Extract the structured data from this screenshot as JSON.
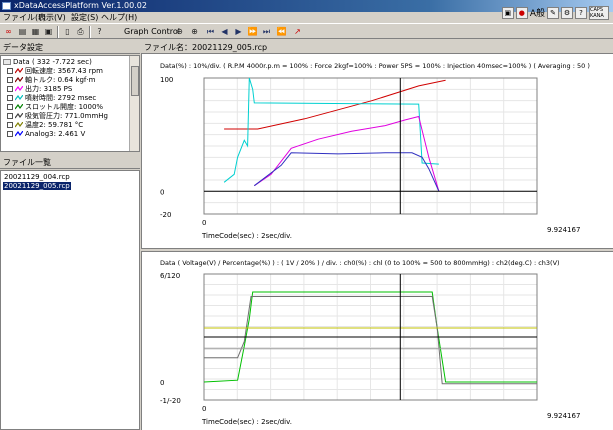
{
  "window": {
    "title": "xDataAccessPlatform  Ver.1.00.02"
  },
  "menu": [
    "ファイル(F)",
    "表示(V)",
    "設定(S)",
    "ヘルプ(H)"
  ],
  "toolbar": {
    "graph_control_label": "Graph Control"
  },
  "status": {
    "caps": "CAPS",
    "kana": "KANA",
    "ime_label": "A般"
  },
  "data_panel": {
    "header": "データ設定",
    "root": "Data ( 332 -7.722 sec)",
    "items": [
      {
        "label": "回転速度: 3567.43 rpm",
        "color": "#c00000"
      },
      {
        "label": "軸トルク: 0.64 kgf·m",
        "color": "#800000"
      },
      {
        "label": "出力: 3185 PS",
        "color": "#ff00ff"
      },
      {
        "label": "噴射時間: 2792 msec",
        "color": "#00c0c0"
      },
      {
        "label": "スロットル開度: 1000%",
        "color": "#008000"
      },
      {
        "label": "吸気管圧力: 771.0mmHg",
        "color": "#404040"
      },
      {
        "label": "温度2: 59.781 °C",
        "color": "#808000"
      },
      {
        "label": "Analog3: 2.461 V",
        "color": "#0000ff"
      }
    ]
  },
  "file_panel": {
    "header": "ファイル一覧",
    "files": [
      "20021129_004.rcp",
      "20021129_005.rcp"
    ],
    "selected_index": 1
  },
  "chart_header": "ファイル名：20021129_005.rcp",
  "chart_data": [
    {
      "type": "line",
      "title": "Data(%) : 10%/div. ( R.P.M 4000r.p.m = 100% : Force 2kgf=100% : Power 5PS = 100% : Injection 40msec=100% ) ( Averaging : 50 )",
      "ylim": [
        -20,
        100
      ],
      "y_ticks": [
        "100",
        "0",
        "-20"
      ],
      "xlim": [
        0,
        9.924167
      ],
      "x_ticks": [
        "0",
        "9.924167"
      ],
      "xlabel": "TimeCode(sec) :  2sec/div.",
      "cursor_x": 5.85,
      "series": [
        {
          "name": "red",
          "color": "#d00000",
          "x": [
            0.6,
            1.6,
            3,
            5,
            6.4,
            7.2
          ],
          "y": [
            55,
            55,
            64,
            80,
            93,
            98
          ]
        },
        {
          "name": "cyan",
          "color": "#00d0d0",
          "x": [
            0.6,
            0.9,
            1.0,
            1.2,
            1.3,
            1.35,
            1.45,
            1.5,
            6.4,
            6.5,
            7.0
          ],
          "y": [
            8,
            15,
            30,
            45,
            40,
            100,
            90,
            78,
            77,
            25,
            24
          ]
        },
        {
          "name": "magenta",
          "color": "#e000e0",
          "x": [
            1.5,
            2.0,
            2.6,
            3.4,
            4.4,
            5.4,
            6.0,
            6.4,
            6.7,
            7.0
          ],
          "y": [
            5,
            15,
            38,
            46,
            53,
            58,
            63,
            66,
            30,
            0
          ]
        },
        {
          "name": "blue",
          "color": "#3030c0",
          "x": [
            1.5,
            2.3,
            2.6,
            4,
            5.4,
            6.2,
            6.5,
            6.7,
            7.0
          ],
          "y": [
            5,
            23,
            34,
            33,
            34,
            34,
            30,
            20,
            0
          ]
        },
        {
          "name": "black",
          "color": "#000000",
          "x": [
            0,
            9.924167
          ],
          "y": [
            0,
            0
          ]
        }
      ]
    },
    {
      "type": "line",
      "title": "Data ( Voltage(V) / Percentage(%) ) : ( 1V / 20% ) / div. : ch0(%) : chl (0 to 100% = 500 to 800mmHg) : ch2(deg.C) : ch3(V)",
      "ylim": [
        -20,
        120
      ],
      "y_ticks": [
        "6/120",
        "0",
        "-1/-20"
      ],
      "xlim": [
        0,
        9.924167
      ],
      "x_ticks": [
        "0",
        "9.924167"
      ],
      "xlabel": "TimeCode(sec) :  2sec/div.",
      "cursor_x": 5.85,
      "series": [
        {
          "name": "green",
          "color": "#00c000",
          "x": [
            0,
            1.0,
            1.2,
            1.35,
            1.45,
            6.8,
            6.95,
            7.2,
            9.924167
          ],
          "y": [
            0,
            2,
            40,
            70,
            100,
            100,
            60,
            0,
            0
          ]
        },
        {
          "name": "gray",
          "color": "#707070",
          "x": [
            0,
            1.0,
            1.2,
            1.4,
            1.5,
            6.8,
            6.95,
            7.1,
            9.924167
          ],
          "y": [
            27,
            27,
            45,
            95,
            95,
            95,
            60,
            -2,
            -2
          ]
        },
        {
          "name": "yellow",
          "color": "#c0c000",
          "x": [
            0,
            9.924167
          ],
          "y": [
            60,
            60
          ]
        },
        {
          "name": "black2",
          "color": "#000000",
          "x": [
            0,
            9.924167
          ],
          "y": [
            50,
            50
          ]
        },
        {
          "name": "gray2",
          "color": "#9a9a9a",
          "x": [
            0,
            9.924167
          ],
          "y": [
            37,
            37
          ]
        }
      ]
    }
  ]
}
